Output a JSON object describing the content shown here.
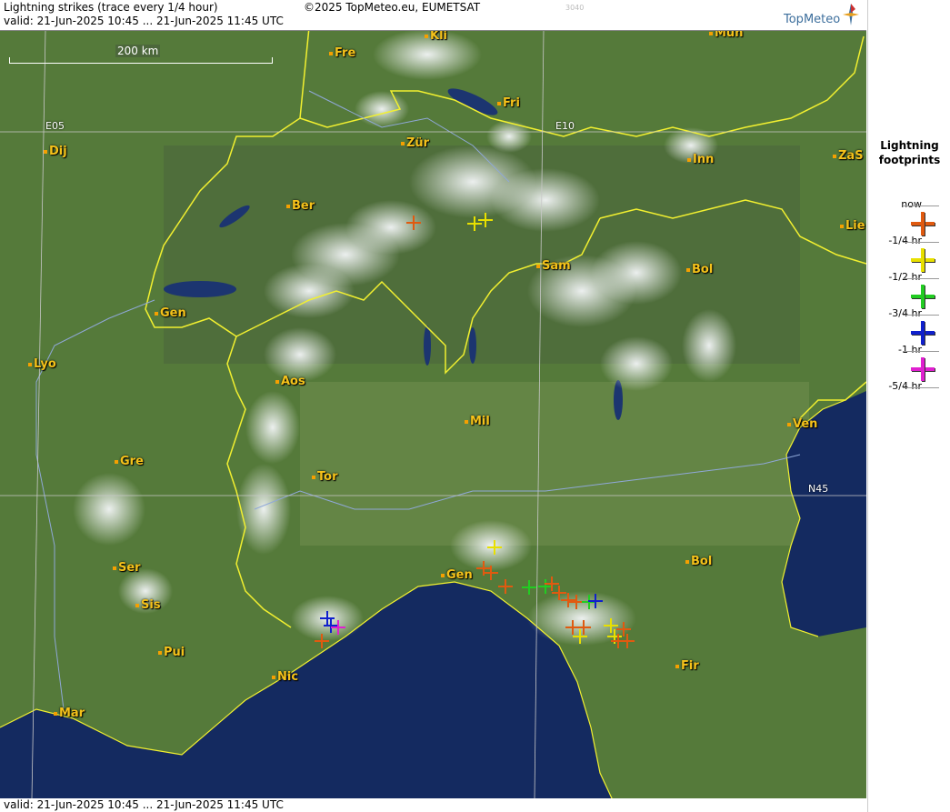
{
  "header": {
    "title": "Lightning strikes (trace every 1/4 hour)",
    "validity": "valid:  21-Jun-2025 10:45 ... 21-Jun-2025 11:45 UTC",
    "copyright": "©2025 TopMeteo.eu, EUMETSAT",
    "code": "3040",
    "logo": "TopMeteo"
  },
  "footer": {
    "validity": "valid:  21-Jun-2025 10:45 ... 21-Jun-2025 11:45 UTC"
  },
  "scale": {
    "label": "200 km"
  },
  "grid": {
    "e05": "E05",
    "e10": "E10",
    "n45": "N45"
  },
  "cities": [
    {
      "key": "kli",
      "label": "Kli"
    },
    {
      "key": "mun",
      "label": "Mun"
    },
    {
      "key": "fre",
      "label": "Fre"
    },
    {
      "key": "fri",
      "label": "Fri"
    },
    {
      "key": "dij",
      "label": "Dij"
    },
    {
      "key": "zur",
      "label": "Zür"
    },
    {
      "key": "inn",
      "label": "Inn"
    },
    {
      "key": "zas",
      "label": "ZaS"
    },
    {
      "key": "ber",
      "label": "Ber"
    },
    {
      "key": "lie",
      "label": "Lie"
    },
    {
      "key": "sam",
      "label": "Sam"
    },
    {
      "key": "bol1",
      "label": "Bol"
    },
    {
      "key": "gen1",
      "label": "Gen"
    },
    {
      "key": "lyo",
      "label": "Lyo"
    },
    {
      "key": "aos",
      "label": "Aos"
    },
    {
      "key": "mil",
      "label": "Mil"
    },
    {
      "key": "ven",
      "label": "Ven"
    },
    {
      "key": "gre",
      "label": "Gre"
    },
    {
      "key": "tor",
      "label": "Tor"
    },
    {
      "key": "ser",
      "label": "Ser"
    },
    {
      "key": "gen2",
      "label": "Gen"
    },
    {
      "key": "bol2",
      "label": "Bol"
    },
    {
      "key": "sis",
      "label": "Sis"
    },
    {
      "key": "pui",
      "label": "Pui"
    },
    {
      "key": "fir",
      "label": "Fir"
    },
    {
      "key": "nic",
      "label": "Nic"
    },
    {
      "key": "mar",
      "label": "Mar"
    }
  ],
  "legend": {
    "title_line1": "Lightning",
    "title_line2": "footprints",
    "ticks": [
      "now",
      "-1/4 hr",
      "-1/2 hr",
      "-3/4 hr",
      "-1 hr",
      "-5/4 hr"
    ],
    "items": [
      {
        "key": "q0",
        "color": "#e05a10"
      },
      {
        "key": "q1",
        "color": "#e8e000"
      },
      {
        "key": "q2",
        "color": "#22cc22"
      },
      {
        "key": "q3",
        "color": "#1020cc"
      },
      {
        "key": "q4",
        "color": "#e020d0"
      }
    ]
  },
  "colors": {
    "border": "#f2f030",
    "river": "#8fa8d8",
    "sea": "#142a60",
    "cloud": "#f0f2f4"
  }
}
